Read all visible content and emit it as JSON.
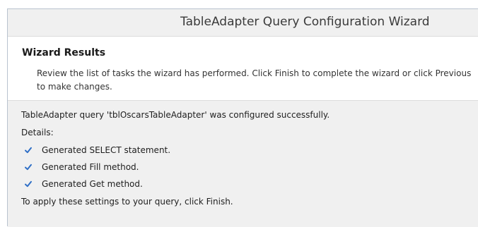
{
  "window": {
    "title": "TableAdapter Query Configuration Wizard"
  },
  "header": {
    "title": "Wizard Results",
    "description": "Review the list of tasks the wizard has performed. Click Finish to complete the wizard or click Previous to make changes."
  },
  "content": {
    "status": "TableAdapter query 'tblOscarsTableAdapter' was configured successfully.",
    "details_label": "Details:",
    "tasks": [
      {
        "label": "Generated SELECT statement.",
        "icon": "checkmark-icon"
      },
      {
        "label": "Generated Fill method.",
        "icon": "checkmark-icon"
      },
      {
        "label": "Generated Get method.",
        "icon": "checkmark-icon"
      }
    ],
    "footer": "To apply these settings to your query, click Finish."
  },
  "colors": {
    "check": "#2f6fc6",
    "window_bg": "#f0f0f0",
    "header_bg": "#ffffff"
  }
}
